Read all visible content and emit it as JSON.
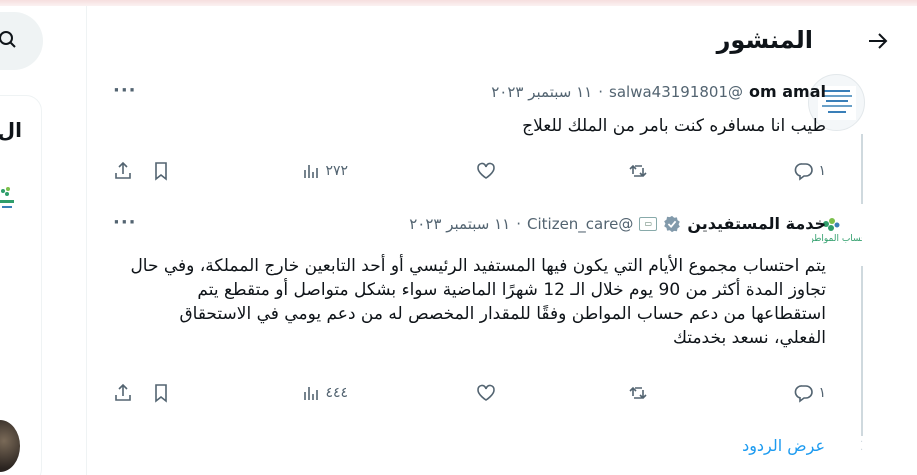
{
  "page": {
    "title": "المنشور",
    "show_replies": "عرض الردود"
  },
  "sidebar": {
    "partial_title": "ال"
  },
  "tweets": [
    {
      "name": "om amal",
      "handle": "@salwa43191801",
      "dot": "·",
      "date": "١١ سبتمبر ٢٠٢٣",
      "text": "طيب انا مسافره كنت بامر من الملك للعلاج",
      "replies": "١",
      "retweets": "",
      "likes": "",
      "views": "٢٧٢",
      "verified": false
    },
    {
      "name": "خدمة المستفيدين",
      "handle": "@Citizen_care",
      "dot": "·",
      "date": "١١ سبتمبر ٢٠٢٣",
      "text": "يتم احتساب مجموع الأيام التي يكون فيها المستفيد الرئيسي أو أحد التابعين خارج المملكة، وفي حال تجاوز المدة أكثر من 90 يوم خلال الـ 12 شهرًا الماضية سواء بشكل متواصل أو متقطع يتم استقطاعها من دعم حساب المواطن وفقًا للمقدار المخصص له من دعم يومي في الاستحقاق الفعلي، نسعد بخدمتك",
      "replies": "١",
      "retweets": "",
      "likes": "",
      "views": "٤٤٤",
      "verified": true,
      "logo_text": "حساب المواطن"
    }
  ],
  "colors": {
    "accent": "#1d9bf0",
    "muted": "#536471",
    "verified": "#829aab",
    "logo_green": "#2f9e6b"
  }
}
